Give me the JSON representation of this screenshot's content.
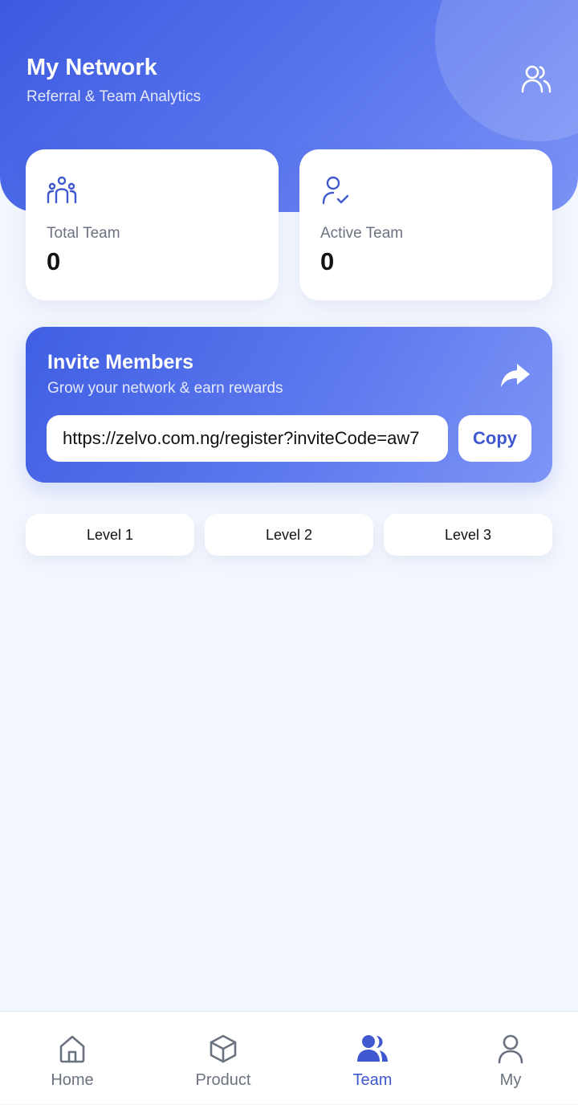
{
  "colors": {
    "primary": "#3f58cf",
    "gradient_start": "#3d5ae0",
    "gradient_end": "#7b93f6",
    "background": "#f2f6fd",
    "muted_text": "#6b7280"
  },
  "header": {
    "title": "My Network",
    "subtitle": "Referral & Team Analytics",
    "icon": "team-users-icon"
  },
  "stats": [
    {
      "label": "Total Team",
      "value": "0",
      "icon": "team-group-icon"
    },
    {
      "label": "Active Team",
      "value": "0",
      "icon": "user-check-icon"
    }
  ],
  "invite": {
    "title": "Invite Members",
    "subtitle": "Grow your network & earn rewards",
    "link": "https://zelvo.com.ng/register?inviteCode=aw7",
    "copy_label": "Copy",
    "share_icon": "share-icon"
  },
  "levels": [
    {
      "label": "Level 1"
    },
    {
      "label": "Level 2"
    },
    {
      "label": "Level 3"
    }
  ],
  "nav": [
    {
      "label": "Home",
      "icon": "home-icon",
      "active": false
    },
    {
      "label": "Product",
      "icon": "box-icon",
      "active": false
    },
    {
      "label": "Team",
      "icon": "team-icon",
      "active": true
    },
    {
      "label": "My",
      "icon": "person-icon",
      "active": false
    }
  ]
}
